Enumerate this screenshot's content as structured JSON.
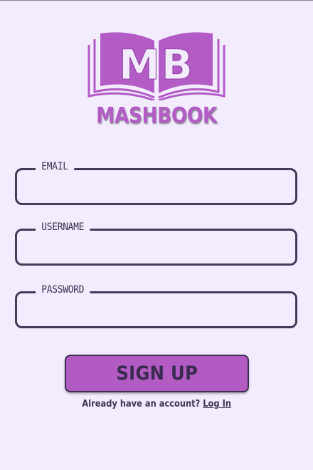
{
  "app": {
    "logo_initials": "MB",
    "brand_name": "MASHBOOK",
    "brand_color": "#B35CC6"
  },
  "form": {
    "email": {
      "label": "EMAIL",
      "value": ""
    },
    "username": {
      "label": "USERNAME",
      "value": ""
    },
    "password": {
      "label": "PASSWORD",
      "value": ""
    }
  },
  "actions": {
    "signup_label": "SIGN UP",
    "login_prompt": "Already have an account?",
    "login_link": "Log In"
  },
  "colors": {
    "background": "#F3ECFF",
    "border": "#453A5A",
    "button": "#B25BC3"
  },
  "icons": {
    "logo": "open-book-icon"
  }
}
